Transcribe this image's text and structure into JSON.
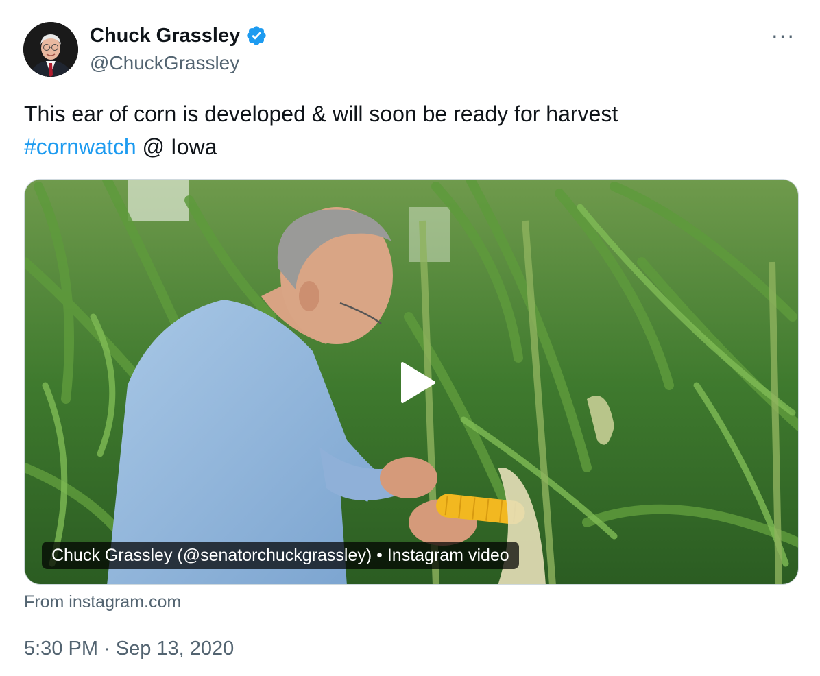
{
  "author": {
    "display_name": "Chuck Grassley",
    "handle": "@ChuckGrassley",
    "verified_icon": "verified-badge-icon"
  },
  "menu": {
    "more_label": "···"
  },
  "tweet": {
    "line1": "This ear of corn is developed & will soon be ready for harvest",
    "hashtag": "#cornwatch",
    "after_hashtag": " @ Iowa"
  },
  "media": {
    "caption": "Chuck Grassley (@senatorchuckgrassley) • Instagram video",
    "play_icon": "play-icon"
  },
  "source": "From instagram.com",
  "timestamp": "5:30 PM · Sep 13, 2020",
  "colors": {
    "link": "#1d9bf0",
    "secondary_text": "#536471",
    "verified": "#1d9bf0"
  }
}
